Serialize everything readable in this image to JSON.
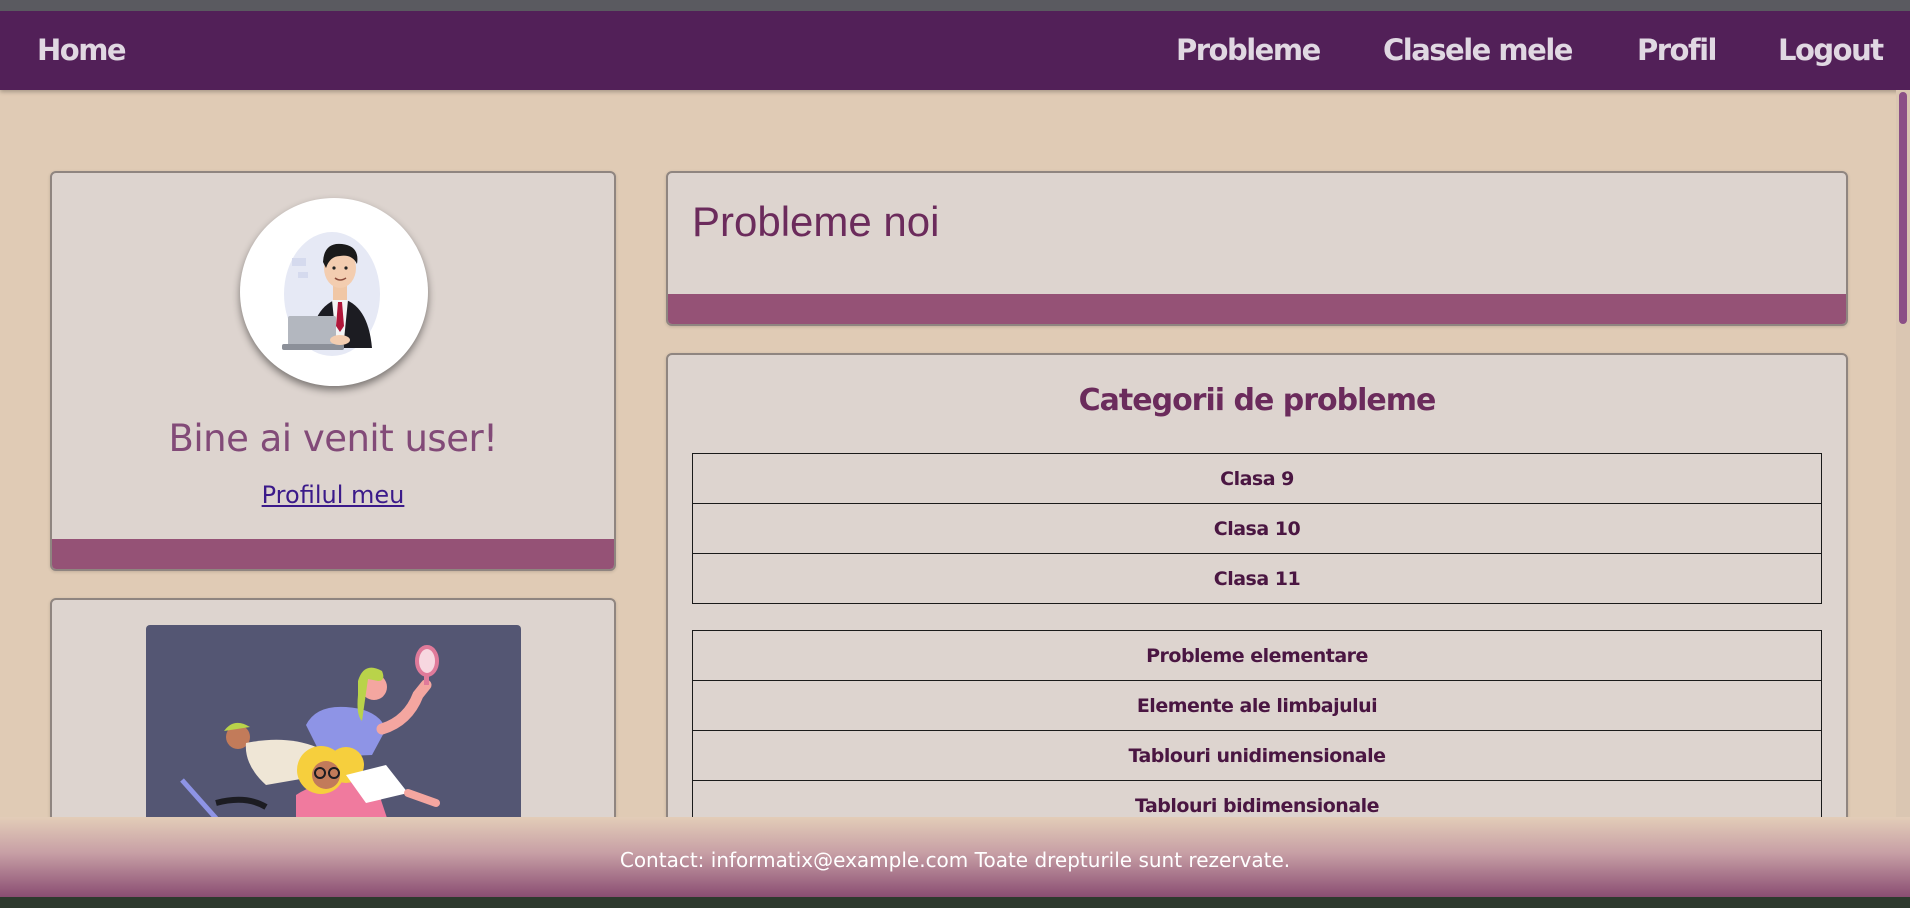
{
  "nav": {
    "home": "Home",
    "probleme": "Probleme",
    "clasele_mele": "Clasele mele",
    "profil": "Profil",
    "logout": "Logout"
  },
  "welcome_card": {
    "greeting": "Bine ai venit user!",
    "profile_link": "Profilul meu"
  },
  "new_problems": {
    "title": "Probleme noi"
  },
  "categories": {
    "title": "Categorii de probleme",
    "classes": [
      "Clasa 9",
      "Clasa 10",
      "Clasa 11"
    ],
    "topics": [
      "Probleme elementare",
      "Elemente ale limbajului",
      "Tablouri unidimensionale",
      "Tablouri bidimensionale"
    ]
  },
  "footer": {
    "text": "Contact: informatix@example.com Toate drepturile sunt rezervate."
  },
  "colors": {
    "navbar": "#522058",
    "page_background": "#e0cbb5",
    "card_background": "#ddd4cf",
    "card_bar": "#955276",
    "heading": "#6b2b5c"
  }
}
